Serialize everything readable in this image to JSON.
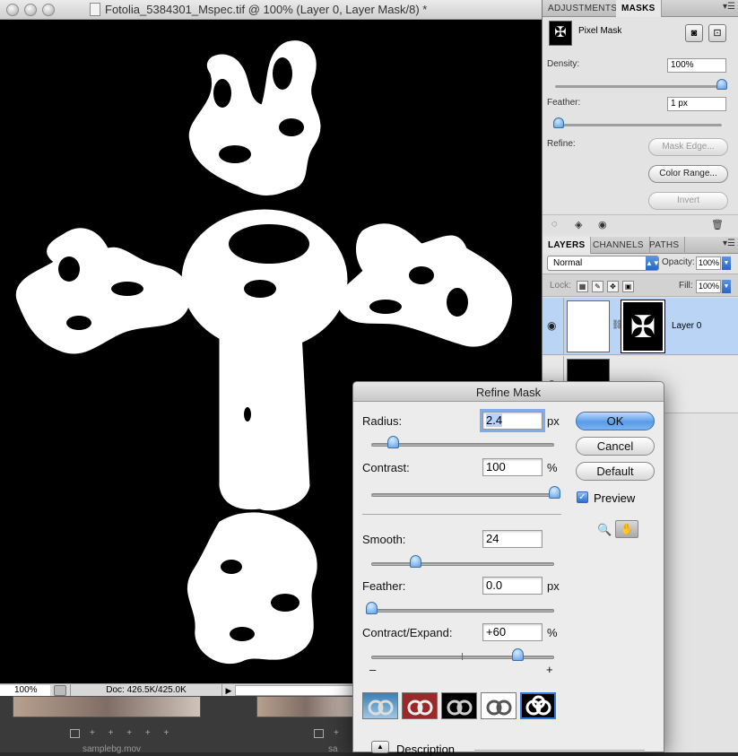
{
  "document": {
    "title": "Fotolia_5384301_Mspec.tif @ 100% (Layer 0, Layer Mask/8) *",
    "zoom": "100%",
    "doc_size": "Doc: 426.5K/425.0K"
  },
  "filmstrip": {
    "label_left": "samplebg.mov",
    "label_right": "sa"
  },
  "masks_panel": {
    "tabs": [
      "ADJUSTMENTS",
      "MASKS"
    ],
    "active_tab": "MASKS",
    "title": "Pixel Mask",
    "density_label": "Density:",
    "density_value": "100%",
    "density_level": 1.0,
    "feather_label": "Feather:",
    "feather_value": "1 px",
    "feather_level": 0.02,
    "refine_label": "Refine:",
    "mask_edge_button": "Mask Edge...",
    "color_range_button": "Color Range...",
    "invert_button": "Invert"
  },
  "layers_panel": {
    "tabs": [
      "LAYERS",
      "CHANNELS",
      "PATHS"
    ],
    "active_tab": "LAYERS",
    "blend_mode": "Normal",
    "opacity_label": "Opacity:",
    "opacity_value": "100%",
    "lock_label": "Lock:",
    "fill_label": "Fill:",
    "fill_value": "100%",
    "layers": [
      {
        "name": "Layer 0",
        "selected": true
      },
      {
        "name": "",
        "selected": false
      }
    ]
  },
  "refine_mask_dialog": {
    "title": "Refine Mask",
    "radius": {
      "label": "Radius:",
      "value": "2.4",
      "unit": "px",
      "level": 0.12
    },
    "contrast": {
      "label": "Contrast:",
      "value": "100",
      "unit": "%",
      "level": 1.0
    },
    "smooth": {
      "label": "Smooth:",
      "value": "24",
      "unit": "",
      "level": 0.24
    },
    "feather": {
      "label": "Feather:",
      "value": "0.0",
      "unit": "px",
      "level": 0.0
    },
    "contract_expand": {
      "label": "Contract/Expand:",
      "value": "+60",
      "unit": "%",
      "level": 0.8
    },
    "minus": "–",
    "plus": "+",
    "ok_button": "OK",
    "cancel_button": "Cancel",
    "default_button": "Default",
    "preview_label": "Preview",
    "preview_checked": true,
    "description_label": "Description"
  },
  "colors": {
    "accent": "#5a9ae8",
    "selected_layer": "#b9d4f5"
  }
}
